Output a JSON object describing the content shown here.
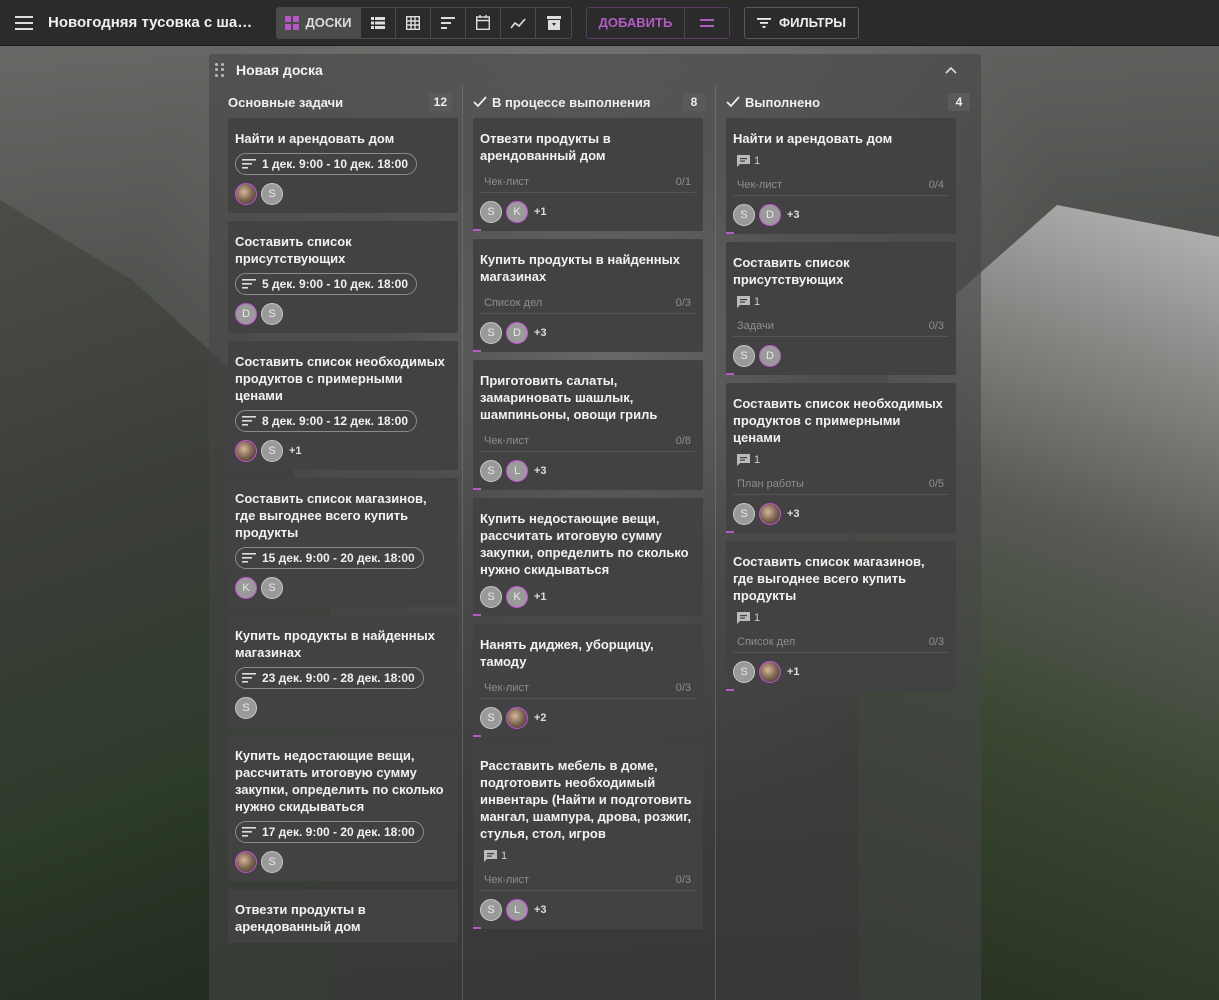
{
  "app": {
    "board_title": "Новогодняя тусовка с шашл...",
    "views": [
      {
        "name": "boards",
        "label": "ДОСКИ",
        "active": true
      },
      {
        "name": "list"
      },
      {
        "name": "table"
      },
      {
        "name": "gantt"
      },
      {
        "name": "calendar"
      },
      {
        "name": "chart"
      },
      {
        "name": "archive"
      }
    ],
    "add_label": "ДОБАВИТЬ",
    "filter_label": "ФИЛЬТРЫ",
    "accent_color": "#b25bc4"
  },
  "board": {
    "name": "Новая доска",
    "columns": [
      {
        "title": "Основные задачи",
        "count": "12",
        "checked": false,
        "cards": [
          {
            "title": "Найти и арендовать дом",
            "date": "1 дек. 9:00 - 10 дек. 18:00",
            "avatars": [
              "photo",
              "S"
            ],
            "more": ""
          },
          {
            "title": "Составить список присутствующих",
            "date": "5 дек. 9:00 - 10 дек. 18:00",
            "avatars": [
              "D",
              "S"
            ],
            "more": ""
          },
          {
            "title": "Составить список необходимых продуктов с примерными ценами",
            "date": "8 дек. 9:00 - 12 дек. 18:00",
            "avatars": [
              "photo",
              "S"
            ],
            "more": "+1"
          },
          {
            "title": "Составить список магазинов, где выгоднее всего купить продукты",
            "date": "15 дек. 9:00 - 20 дек. 18:00",
            "avatars": [
              "K",
              "S"
            ],
            "more": ""
          },
          {
            "title": "Купить продукты в найденных магазинах",
            "date": "23 дек. 9:00 - 28 дек. 18:00",
            "avatars": [
              "S"
            ],
            "more": ""
          },
          {
            "title": "Купить недостающие вещи, рассчитать итоговую сумму закупки, определить по сколько нужно скидываться",
            "date": "17 дек. 9:00 - 20 дек. 18:00",
            "avatars": [
              "photo",
              "S"
            ],
            "more": ""
          },
          {
            "title": "Отвезти продукты в арендованный дом",
            "date": "",
            "avatars": [],
            "more": ""
          }
        ]
      },
      {
        "title": "В процессе выполнения",
        "count": "8",
        "checked": true,
        "cards": [
          {
            "title": "Отвезти продукты в арендованный дом",
            "checklist": "Чек-лист",
            "progress": "0/1",
            "avatars": [
              "S",
              "K"
            ],
            "more": "+1"
          },
          {
            "title": "Купить продукты в найденных магазинах",
            "checklist": "Список дел",
            "progress": "0/3",
            "avatars": [
              "S",
              "D"
            ],
            "more": "+3"
          },
          {
            "title": "Приготовить салаты, замариновать шашлык, шампиньоны, овощи гриль",
            "checklist": "Чек-лист",
            "progress": "0/8",
            "avatars": [
              "S",
              "L"
            ],
            "more": "+3"
          },
          {
            "title": "Купить недостающие вещи, рассчитать итоговую сумму закупки, определить по сколько нужно скидываться",
            "checklist": "",
            "progress": "",
            "avatars": [
              "S",
              "K"
            ],
            "more": "+1"
          },
          {
            "title": "Нанять диджея, уборщицу, тамоду",
            "checklist": "Чек-лист",
            "progress": "0/3",
            "avatars": [
              "S",
              "photo"
            ],
            "more": "+2"
          },
          {
            "title": "Расставить мебель в доме, подготовить необходимый инвентарь (Найти и подготовить мангал, шампура, дрова, розжиг, стулья, стол, игров",
            "comments": "1",
            "checklist": "Чек-лист",
            "progress": "0/3",
            "avatars": [
              "S",
              "L"
            ],
            "more": "+3"
          }
        ]
      },
      {
        "title": "Выполнено",
        "count": "4",
        "checked": true,
        "cards": [
          {
            "title": "Найти и арендовать дом",
            "comments": "1",
            "checklist": "Чек-лист",
            "progress": "0/4",
            "avatars": [
              "S",
              "D"
            ],
            "more": "+3"
          },
          {
            "title": "Составить список присутствующих",
            "comments": "1",
            "checklist": "Задачи",
            "progress": "0/3",
            "avatars": [
              "S",
              "D"
            ],
            "more": ""
          },
          {
            "title": "Составить список необходимых продуктов с примерными ценами",
            "comments": "1",
            "checklist": "План работы",
            "progress": "0/5",
            "avatars": [
              "S",
              "photo"
            ],
            "more": "+3"
          },
          {
            "title": "Составить список магазинов, где выгоднее всего купить продукты",
            "comments": "1",
            "checklist": "Список дел",
            "progress": "0/3",
            "avatars": [
              "S",
              "photo"
            ],
            "more": "+1"
          }
        ]
      }
    ]
  }
}
